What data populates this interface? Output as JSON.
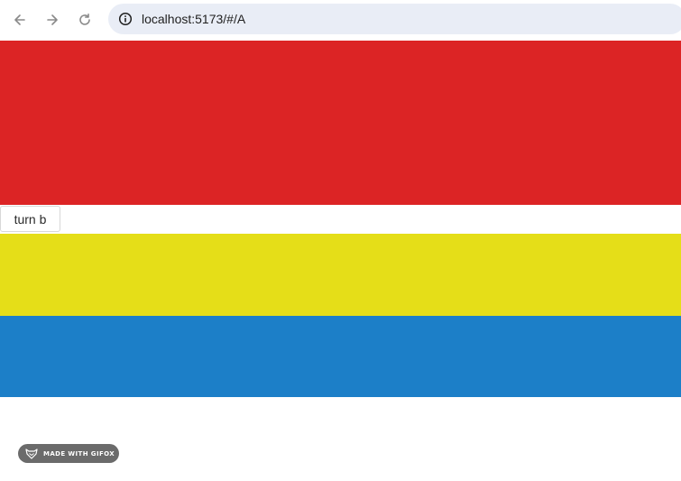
{
  "browser": {
    "url": "localhost:5173/#/A",
    "icons": {
      "back": "arrow-left-icon",
      "forward": "arrow-right-icon",
      "reload": "reload-icon",
      "site_info": "info-icon"
    }
  },
  "page": {
    "blocks": [
      {
        "name": "red",
        "color": "#dc2425"
      },
      {
        "name": "yellow",
        "color": "#e5de18"
      },
      {
        "name": "blue",
        "color": "#1c7fc8"
      }
    ],
    "button_label": "turn b"
  },
  "watermark": {
    "text": "MADE WITH GIFOX",
    "icon": "gifox-fox-icon"
  }
}
